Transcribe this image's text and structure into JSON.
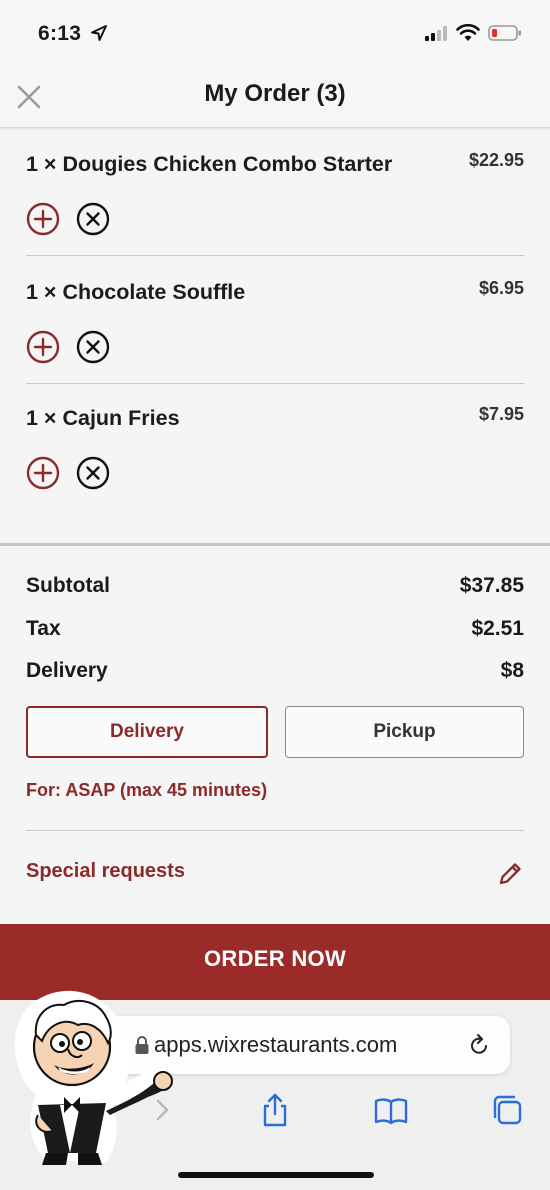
{
  "status_bar": {
    "time": "6:13"
  },
  "header": {
    "title": "My Order (3)"
  },
  "items": [
    {
      "name": "1 × Dougies Chicken Combo Starter",
      "price": "$22.95"
    },
    {
      "name": "1 × Chocolate Souffle",
      "price": "$6.95"
    },
    {
      "name": "1 × Cajun Fries",
      "price": "$7.95"
    }
  ],
  "summary": {
    "subtotal_label": "Subtotal",
    "subtotal_value": "$37.85",
    "tax_label": "Tax",
    "tax_value": "$2.51",
    "delivery_label": "Delivery",
    "delivery_value": "$8"
  },
  "mode": {
    "delivery_label": "Delivery",
    "pickup_label": "Pickup",
    "selected": "Delivery"
  },
  "eta": "For: ASAP (max 45 minutes)",
  "special_requests": "Special requests",
  "order_button": "ORDER NOW",
  "browser": {
    "url": "apps.wixrestaurants.com"
  },
  "colors": {
    "accent": "#8b2a2a",
    "order_button": "#9a2b28"
  }
}
